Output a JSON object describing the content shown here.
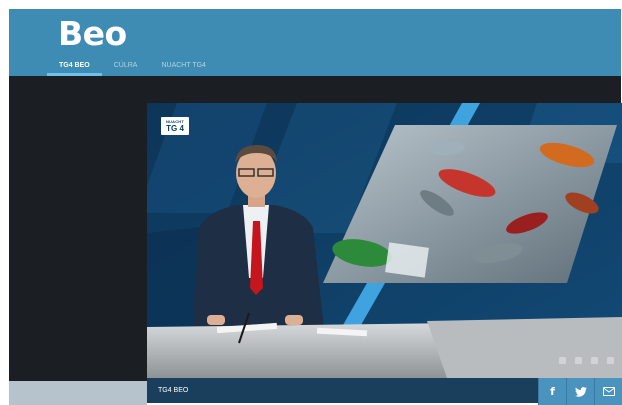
{
  "header": {
    "logo": "Beo",
    "nav": [
      {
        "label": "TG4 BEO",
        "active": true
      },
      {
        "label": "CÚLRA",
        "active": false
      },
      {
        "label": "NUACHT TG4",
        "active": false
      }
    ]
  },
  "player": {
    "badge_top": "NUACHT",
    "badge_main": "TG 4"
  },
  "caption": {
    "label": "TG4 BEO"
  },
  "share": {
    "facebook_icon": "facebook-icon",
    "twitter_icon": "twitter-icon",
    "mail_icon": "mail-icon",
    "facebook_glyph": "f"
  },
  "colors": {
    "header_blue": "#3e8bb3",
    "nav_underline": "#6fc0ea",
    "dark_bg": "#1b1f24",
    "caption_bg": "#1a3f5c",
    "share_bg": "#4a93be",
    "tie_red": "#c4161c"
  }
}
